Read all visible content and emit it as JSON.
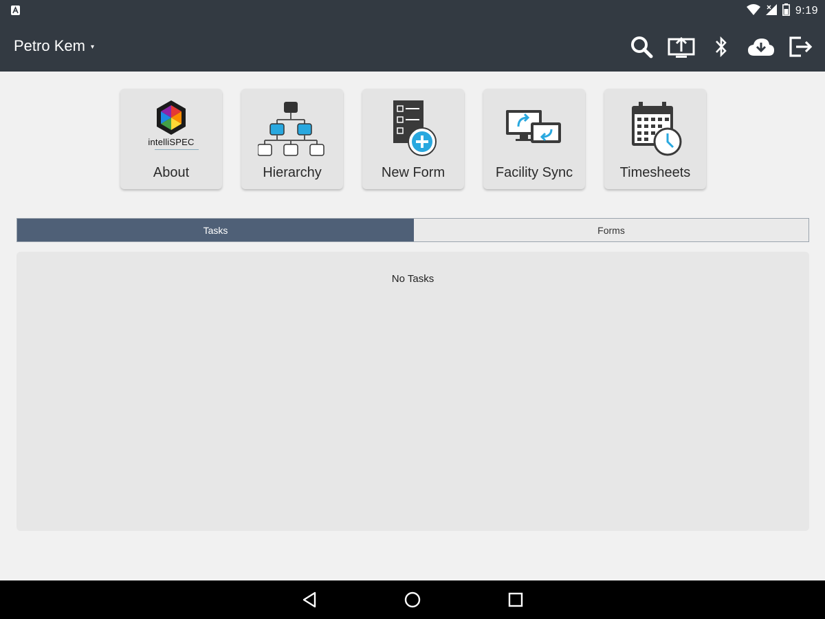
{
  "status_bar": {
    "time": "9:19",
    "icons": [
      "notification-icon",
      "wifi-icon",
      "signal-icon",
      "battery-icon"
    ]
  },
  "app_bar": {
    "title": "Petro Kem",
    "dropdown_caret": "▾",
    "actions": [
      "search-icon",
      "upload-icon",
      "bluetooth-icon",
      "cloud-download-icon",
      "logout-icon"
    ]
  },
  "tiles": [
    {
      "label": "About",
      "icon": "intellispec-logo-icon",
      "brand_text": "intelliSPEC"
    },
    {
      "label": "Hierarchy",
      "icon": "hierarchy-icon"
    },
    {
      "label": "New Form",
      "icon": "new-form-icon"
    },
    {
      "label": "Facility Sync",
      "icon": "facility-sync-icon"
    },
    {
      "label": "Timesheets",
      "icon": "timesheets-icon"
    }
  ],
  "tabs": [
    {
      "label": "Tasks",
      "active": true
    },
    {
      "label": "Forms",
      "active": false
    }
  ],
  "content": {
    "empty_message": "No Tasks"
  },
  "nav_bar": {
    "buttons": [
      "back-icon",
      "home-icon",
      "recents-icon"
    ]
  },
  "colors": {
    "app_bar": "#333a42",
    "active_tab": "#4f6077",
    "accent_blue": "#29a8df",
    "background": "#f1f1f1"
  }
}
